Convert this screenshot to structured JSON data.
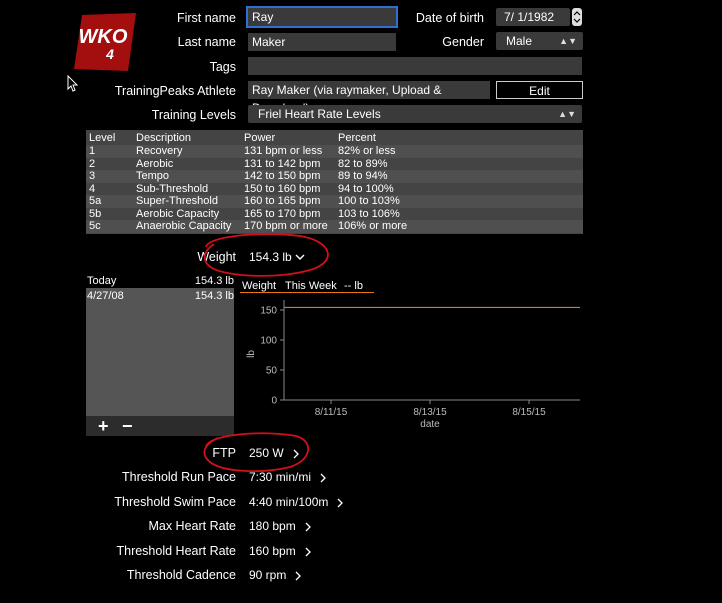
{
  "logo": {
    "text": "WKO",
    "sub": "4"
  },
  "profile": {
    "first_name_label": "First name",
    "first_name_value": "Ray",
    "last_name_label": "Last name",
    "last_name_value": "Maker",
    "tags_label": "Tags",
    "tags_value": "",
    "dob_label": "Date of birth",
    "dob_value": "7/  1/1982",
    "gender_label": "Gender",
    "gender_value": "Male",
    "tp_label": "TrainingPeaks Athlete",
    "tp_value": "Ray Maker (via raymaker, Upload & Download)",
    "edit_label": "Edit",
    "training_levels_label": "Training Levels",
    "training_levels_value": "Friel Heart Rate Levels"
  },
  "levels_table": {
    "headers": [
      "Level",
      "Description",
      "Power",
      "Percent"
    ],
    "rows": [
      [
        "1",
        "Recovery",
        "131 bpm or less",
        "82% or less"
      ],
      [
        "2",
        "Aerobic",
        "131 to 142 bpm",
        "82 to 89%"
      ],
      [
        "3",
        "Tempo",
        "142 to 150 bpm",
        "89 to 94%"
      ],
      [
        "4",
        "Sub-Threshold",
        "150 to 160 bpm",
        "94 to 100%"
      ],
      [
        "5a",
        "Super-Threshold",
        "160 to 165 bpm",
        "100 to 103%"
      ],
      [
        "5b",
        "Aerobic Capacity",
        "165 to 170 bpm",
        "103 to 106%"
      ],
      [
        "5c",
        "Anaerobic Capacity",
        "170 bpm or more",
        "106% or more"
      ]
    ]
  },
  "weight": {
    "label": "Weight",
    "value": "154.3 lb",
    "list": [
      {
        "date": "Today",
        "value": "154.3 lb"
      },
      {
        "date": "4/27/08",
        "value": "154.3 lb"
      }
    ],
    "add_label": "+",
    "remove_label": "−"
  },
  "weight_chart": {
    "tabs": [
      "Weight",
      "This Week",
      "-- lb"
    ]
  },
  "chart_data": {
    "type": "line",
    "x": [
      "8/10/15",
      "8/16/15"
    ],
    "series": [
      {
        "values": [
          154.3,
          154.3
        ]
      }
    ],
    "xlabel": "date",
    "ylabel": "lb",
    "xticks": [
      "8/11/15",
      "8/13/15",
      "8/15/15"
    ],
    "yticks": [
      "0",
      "50",
      "100",
      "150"
    ],
    "ylim": [
      0,
      160
    ],
    "grid": false,
    "line_color": "#e8731a"
  },
  "metrics": [
    {
      "label": "FTP",
      "value": "250 W"
    },
    {
      "label": "Threshold Run Pace",
      "value": "7:30 min/mi"
    },
    {
      "label": "Threshold Swim Pace",
      "value": "4:40 min/100m"
    },
    {
      "label": "Max Heart Rate",
      "value": "180 bpm"
    },
    {
      "label": "Threshold Heart Rate",
      "value": "160 bpm"
    },
    {
      "label": "Threshold Cadence",
      "value": "90 rpm"
    }
  ],
  "colors": {
    "annotation": "#d0101a",
    "accent": "#e8731a",
    "logo": "#a30e0e"
  }
}
